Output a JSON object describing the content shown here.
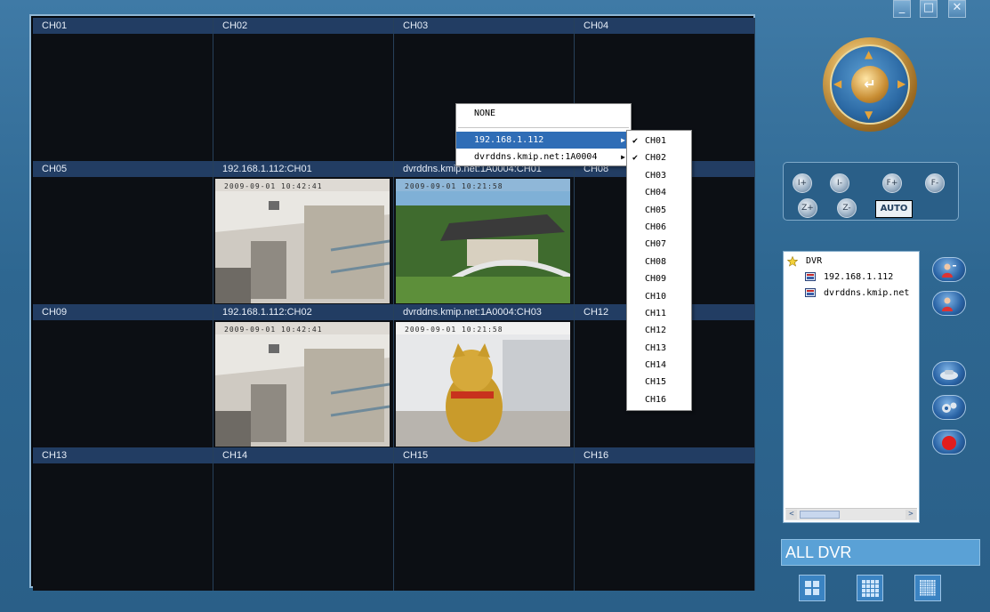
{
  "window_controls": [
    "_",
    "□",
    "✕"
  ],
  "channels": [
    {
      "label": "CH01",
      "video": false
    },
    {
      "label": "CH02",
      "video": false
    },
    {
      "label": "CH03",
      "video": false
    },
    {
      "label": "CH04",
      "video": false
    },
    {
      "label": "CH05",
      "video": false
    },
    {
      "label": "192.168.1.112:CH01",
      "video": "lab",
      "osd": "2009-09-01  10:42:41"
    },
    {
      "label": "dvrddns.kmip.net:1A0004:CH01",
      "video": "garden",
      "osd": "2009-09-01  10:21:58"
    },
    {
      "label": "CH08",
      "video": false
    },
    {
      "label": "CH09",
      "video": false
    },
    {
      "label": "192.168.1.112:CH02",
      "video": "lab",
      "osd": "2009-09-01  10:42:41"
    },
    {
      "label": "dvrddns.kmip.net:1A0004:CH03",
      "video": "cat",
      "osd": "2009-09-01  10:21:58"
    },
    {
      "label": "CH12",
      "video": false
    },
    {
      "label": "CH13",
      "video": false
    },
    {
      "label": "CH14",
      "video": false
    },
    {
      "label": "CH15",
      "video": false
    },
    {
      "label": "CH16",
      "video": false
    }
  ],
  "context_menu": {
    "none_label": "NONE",
    "items": [
      {
        "label": "192.168.1.112",
        "selected": true
      },
      {
        "label": "dvrddns.kmip.net:1A0004",
        "selected": false
      }
    ]
  },
  "submenu": {
    "items": [
      {
        "label": "CH01",
        "checked": true
      },
      {
        "label": "CH02",
        "checked": true
      },
      {
        "label": "CH03",
        "checked": false
      },
      {
        "label": "CH04",
        "checked": false
      },
      {
        "label": "CH05",
        "checked": false
      },
      {
        "label": "CH06",
        "checked": false
      },
      {
        "label": "CH07",
        "checked": false
      },
      {
        "label": "CH08",
        "checked": false
      },
      {
        "label": "CH09",
        "checked": false
      },
      {
        "label": "CH10",
        "checked": false
      },
      {
        "label": "CH11",
        "checked": false
      },
      {
        "label": "CH12",
        "checked": false
      },
      {
        "label": "CH13",
        "checked": false
      },
      {
        "label": "CH14",
        "checked": false
      },
      {
        "label": "CH15",
        "checked": false
      },
      {
        "label": "CH16",
        "checked": false
      }
    ]
  },
  "ptz": {
    "enter_glyph": "↵",
    "arrows": [
      "▲",
      "▼",
      "◀",
      "▶"
    ]
  },
  "control_buttons": [
    "I+",
    "I-",
    "F+",
    "F-",
    "Z+",
    "Z-"
  ],
  "auto_label": "AUTO",
  "tree": {
    "root": "DVR",
    "children": [
      "192.168.1.112",
      "dvrddns.kmip.net"
    ]
  },
  "scroll": {
    "left": "<",
    "right": ">"
  },
  "footer": {
    "all_dvr_label": "ALL DVR"
  },
  "colors": {
    "accent": "#2f6db6",
    "header_bar": "#223d63",
    "panel_bg": "#2e6791"
  }
}
